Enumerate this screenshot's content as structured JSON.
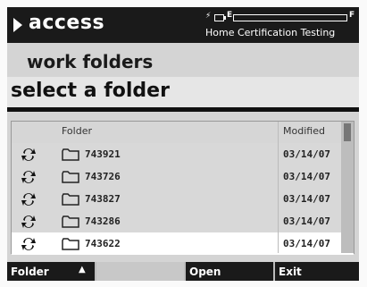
{
  "header": {
    "app_title": "access",
    "subtitle": "Home Certification Testing",
    "fuel_level_e": "E",
    "fuel_level_f": "F",
    "fuel_fraction": 0.0
  },
  "section_title": "work folders",
  "select_title": "select a folder",
  "list": {
    "columns": [
      "Folder",
      "Modified"
    ],
    "rows": [
      {
        "folder": "743921",
        "modified": "03/14/07"
      },
      {
        "folder": "743726",
        "modified": "03/14/07"
      },
      {
        "folder": "743827",
        "modified": "03/14/07"
      },
      {
        "folder": "743286",
        "modified": "03/14/07"
      },
      {
        "folder": "743622",
        "modified": "03/14/07"
      }
    ],
    "selected_index": 4
  },
  "softkeys": {
    "folder": "Folder",
    "folder_arrow": "▲",
    "open": "Open",
    "exit": "Exit"
  }
}
